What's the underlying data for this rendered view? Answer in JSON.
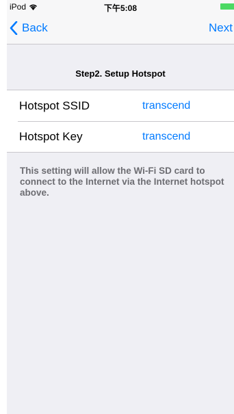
{
  "status_bar": {
    "carrier": "iPod",
    "time": "下午5:08",
    "wifi_icon": "wifi-icon",
    "battery_icon": "battery-icon",
    "battery_color": "#4cd964"
  },
  "nav": {
    "back_label": "Back",
    "next_label": "Next",
    "accent_color": "#007aff"
  },
  "section": {
    "title": "Step2. Setup Hotspot"
  },
  "rows": [
    {
      "label": "Hotspot SSID",
      "value": "transcend"
    },
    {
      "label": "Hotspot Key",
      "value": "transcend"
    }
  ],
  "footer": {
    "text": "This setting will allow the Wi-Fi SD card to connect to the Internet via the Internet hotspot above."
  }
}
